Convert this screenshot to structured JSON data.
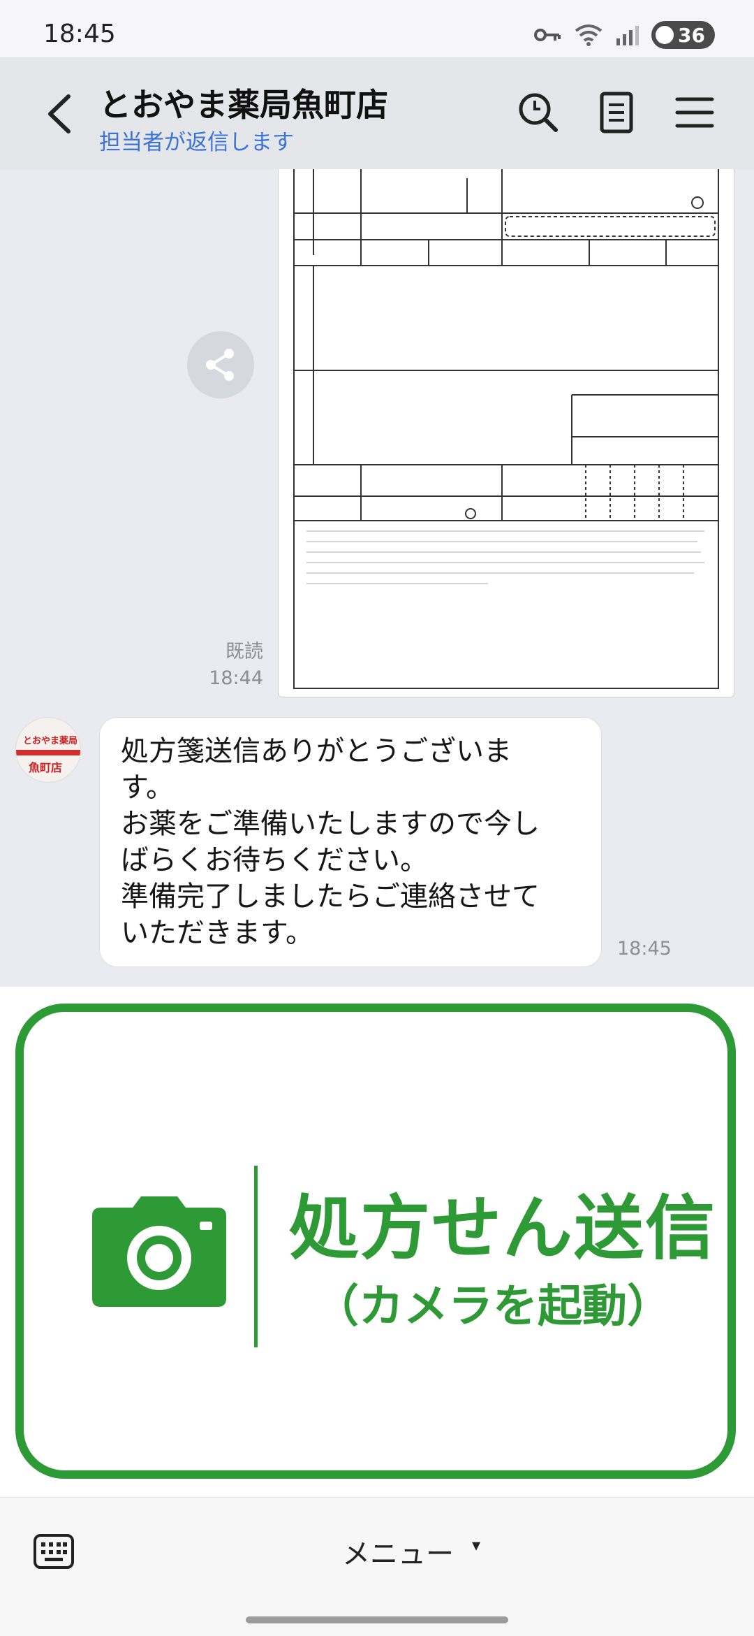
{
  "status_bar": {
    "time": "18:45",
    "battery": "36"
  },
  "header": {
    "title": "とおやま薬局魚町店",
    "subtitle": "担当者が返信します"
  },
  "chat": {
    "sent_image": {
      "read_label": "既読",
      "time": "18:44"
    },
    "received": {
      "avatar_label": "魚町店",
      "avatar_brand": "とおやま薬局",
      "lines": [
        "処方箋送信ありがとうございま",
        "す。",
        "お薬をご準備いたしますので今し",
        "ばらくお待ちください。",
        "準備完了しましたらご連絡させて",
        "いただきます。"
      ],
      "time": "18:45"
    }
  },
  "rich_menu": {
    "main_label": "処方せん送信",
    "sub_label": "（カメラを起動）",
    "accent_color": "#2e9a35"
  },
  "bottom_bar": {
    "menu_label": "メニュー",
    "caret": "▾"
  }
}
